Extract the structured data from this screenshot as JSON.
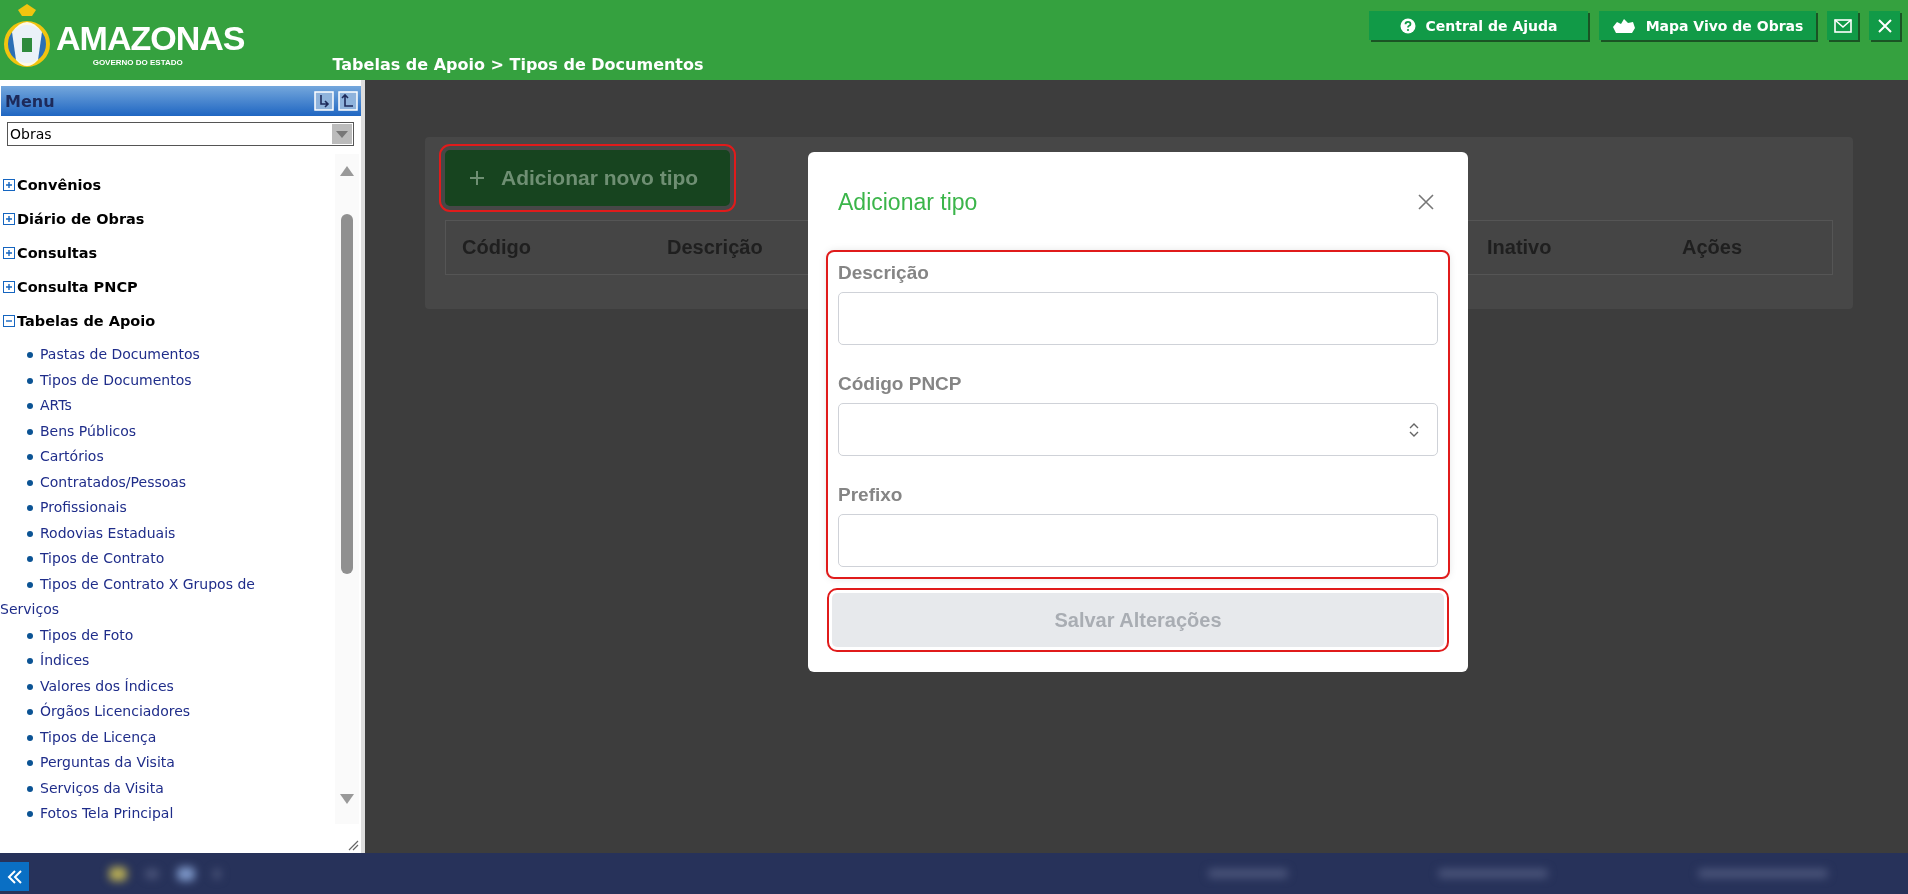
{
  "header": {
    "logo_title": "AMAZONAS",
    "logo_subtitle": "GOVERNO DO ESTADO",
    "breadcrumb": "Tabelas de Apoio > Tipos de Documentos",
    "buttons": [
      {
        "kind": "help",
        "label": "Central de Ajuda"
      },
      {
        "kind": "map",
        "label": "Mapa Vivo de Obras"
      },
      {
        "kind": "mail"
      },
      {
        "kind": "close"
      }
    ]
  },
  "sidebar": {
    "title": "Menu",
    "module_select": {
      "value": "Obras"
    },
    "tree": [
      {
        "label": "Convênios",
        "expanded": false
      },
      {
        "label": "Diário de Obras",
        "expanded": false
      },
      {
        "label": "Consultas",
        "expanded": false
      },
      {
        "label": "Consulta PNCP",
        "expanded": false
      },
      {
        "label": "Tabelas de Apoio",
        "expanded": true,
        "children": [
          {
            "label": "Pastas de Documentos"
          },
          {
            "label": "Tipos de Documentos"
          },
          {
            "label": "ARTs"
          },
          {
            "label": "Bens Públicos"
          },
          {
            "label": "Cartórios"
          },
          {
            "label": "Contratados/Pessoas"
          },
          {
            "label": "Profissionais"
          },
          {
            "label": "Rodovias Estaduais"
          },
          {
            "label": "Tipos de Contrato"
          },
          {
            "label": "Tipos de Contrato X Grupos de Serviços"
          },
          {
            "label": "Tipos de Foto"
          },
          {
            "label": "Índices"
          },
          {
            "label": "Valores dos Índices"
          },
          {
            "label": "Órgãos Licenciadores"
          },
          {
            "label": "Tipos de Licença"
          },
          {
            "label": "Perguntas da Visita"
          },
          {
            "label": "Serviços da Visita"
          },
          {
            "label": "Fotos Tela Principal"
          }
        ]
      }
    ]
  },
  "page": {
    "add_button": {
      "label": "Adicionar novo tipo",
      "highlighted": true
    },
    "table": {
      "columns": [
        "Código",
        "Descrição",
        "Inativo",
        "Ações"
      ]
    }
  },
  "modal": {
    "title": "Adicionar tipo",
    "form_highlighted": true,
    "fields": [
      {
        "kind": "text",
        "label": "Descrição"
      },
      {
        "kind": "select",
        "label": "Código PNCP"
      },
      {
        "kind": "text",
        "label": "Prefixo"
      }
    ],
    "submit": {
      "label": "Salvar Alterações",
      "disabled": true,
      "highlighted": true
    }
  }
}
